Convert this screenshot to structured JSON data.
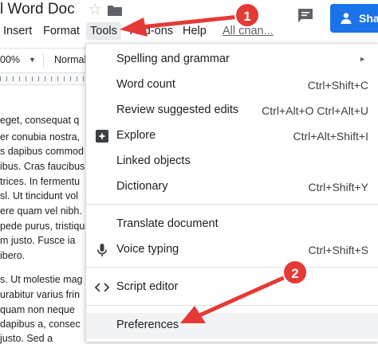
{
  "window": {
    "doc_title": "l Word Doc",
    "share_label": "Shar"
  },
  "menubar": {
    "items": [
      "Insert",
      "Format",
      "Tools",
      "Add-ons",
      "Help"
    ],
    "all_changes": "All chan..."
  },
  "toolbar": {
    "zoom": "00%",
    "style": "Normal"
  },
  "document": {
    "lines": [
      "eget, consequat q",
      "er conubia nostra,",
      "s dapibus commod",
      "ibus. Cras faucibus c",
      "trices. In fermentu",
      "sl. Ut tincidunt vol",
      "ere quam vel nibh.",
      "pede purus, tristiqu",
      "m justo. Fusce ia",
      "ibero.",
      "s. Ut molestie mag",
      "urabitur varius frin",
      "quam non neque",
      "dapibus a, consec",
      "justo. Sed a"
    ]
  },
  "tools_menu": {
    "items": [
      {
        "label": "Spelling and grammar",
        "shortcut": "",
        "submenu": true
      },
      {
        "label": "Word count",
        "shortcut": "Ctrl+Shift+C"
      },
      {
        "label": "Review suggested edits",
        "shortcut": "Ctrl+Alt+O Ctrl+Alt+U"
      },
      {
        "label": "Explore",
        "shortcut": "Ctrl+Alt+Shift+I",
        "icon": "explore-icon"
      },
      {
        "label": "Linked objects",
        "shortcut": ""
      },
      {
        "label": "Dictionary",
        "shortcut": "Ctrl+Shift+Y"
      },
      {
        "label": "Translate document",
        "shortcut": ""
      },
      {
        "label": "Voice typing",
        "shortcut": "Ctrl+Shift+S",
        "icon": "microphone-icon"
      },
      {
        "label": "Script editor",
        "shortcut": "",
        "icon": "code-icon"
      },
      {
        "label": "Preferences",
        "shortcut": ""
      }
    ]
  },
  "annotations": {
    "step1": "1",
    "step2": "2",
    "color": "#e53935"
  }
}
